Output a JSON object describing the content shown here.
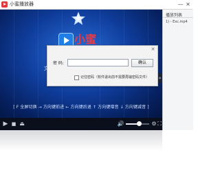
{
  "window": {
    "title": "小蜜播放器",
    "minimize_glyph": "—",
    "close_glyph": "✕"
  },
  "video": {
    "logo_text": "小蜜",
    "left_text": "文",
    "marquee": "[ F 全屏切换 → 方向键前进 ← 方向键后退 ↑ 方向键增音 ↓ 方向键减音 ]"
  },
  "controls": {
    "play_glyph": "▶",
    "stop_glyph": "■",
    "open_glyph": "⏏",
    "volume_glyph": "🔊",
    "volume_level": 0.55,
    "settings_glyph": "⚙",
    "fullscreen_glyph": "⛶",
    "toggle_playlist_glyph": "»"
  },
  "playlist": {
    "title": "播放列表",
    "items": [
      "1) - Exc.mp4"
    ]
  },
  "dialog": {
    "close_glyph": "✕",
    "password_label": "密 码:",
    "password_value": "",
    "ok_label": "确认",
    "remember_label": "记住密码（软件退出前不需要再输密码文件）",
    "remember_checked": false
  },
  "colors": {
    "logo_red": "#e83a44",
    "video_blue": "#0f3d9c",
    "control_bar": "#0b0f1c"
  }
}
